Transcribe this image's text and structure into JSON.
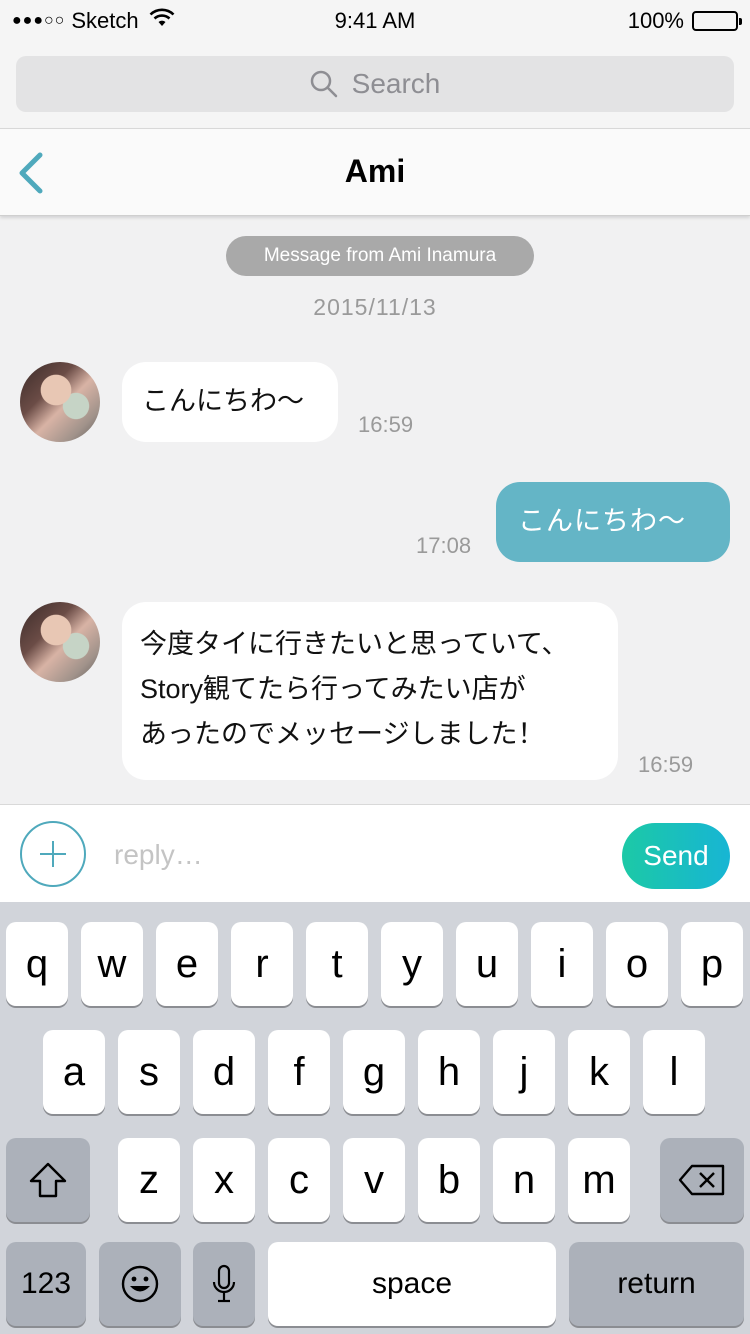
{
  "status_bar": {
    "signal_dots": "●●●○○",
    "carrier": "Sketch",
    "time": "9:41 AM",
    "battery": "100%"
  },
  "search": {
    "placeholder": "Search"
  },
  "nav": {
    "title": "Ami"
  },
  "chat": {
    "system_pill": "Message from Ami Inamura",
    "date": "2015/11/13",
    "messages": [
      {
        "direction": "in",
        "lines": [
          "こんにちわ〜"
        ],
        "time": "16:59"
      },
      {
        "direction": "out",
        "lines": [
          "こんにちわ〜"
        ],
        "time": "17:08"
      },
      {
        "direction": "in",
        "lines": [
          "今度タイに行きたいと思っていて、",
          "Story観てたら行ってみたい店が",
          "あったのでメッセージしました！"
        ],
        "time": "16:59"
      }
    ]
  },
  "input": {
    "placeholder": "reply…",
    "send_label": "Send"
  },
  "keyboard": {
    "row1": [
      "q",
      "w",
      "e",
      "r",
      "t",
      "y",
      "u",
      "i",
      "o",
      "p"
    ],
    "row2": [
      "a",
      "s",
      "d",
      "f",
      "g",
      "h",
      "j",
      "k",
      "l"
    ],
    "row3": [
      "z",
      "x",
      "c",
      "v",
      "b",
      "n",
      "m"
    ],
    "numbers_label": "123",
    "space_label": "space",
    "return_label": "return",
    "icons": {
      "shift": "shift-icon",
      "delete": "backspace-icon",
      "emoji": "emoji-icon",
      "mic": "microphone-icon"
    }
  },
  "colors": {
    "accent": "#64b5c6",
    "send_start": "#1cc9a6",
    "send_end": "#17b5d4",
    "back_arrow": "#4fa9bc"
  }
}
